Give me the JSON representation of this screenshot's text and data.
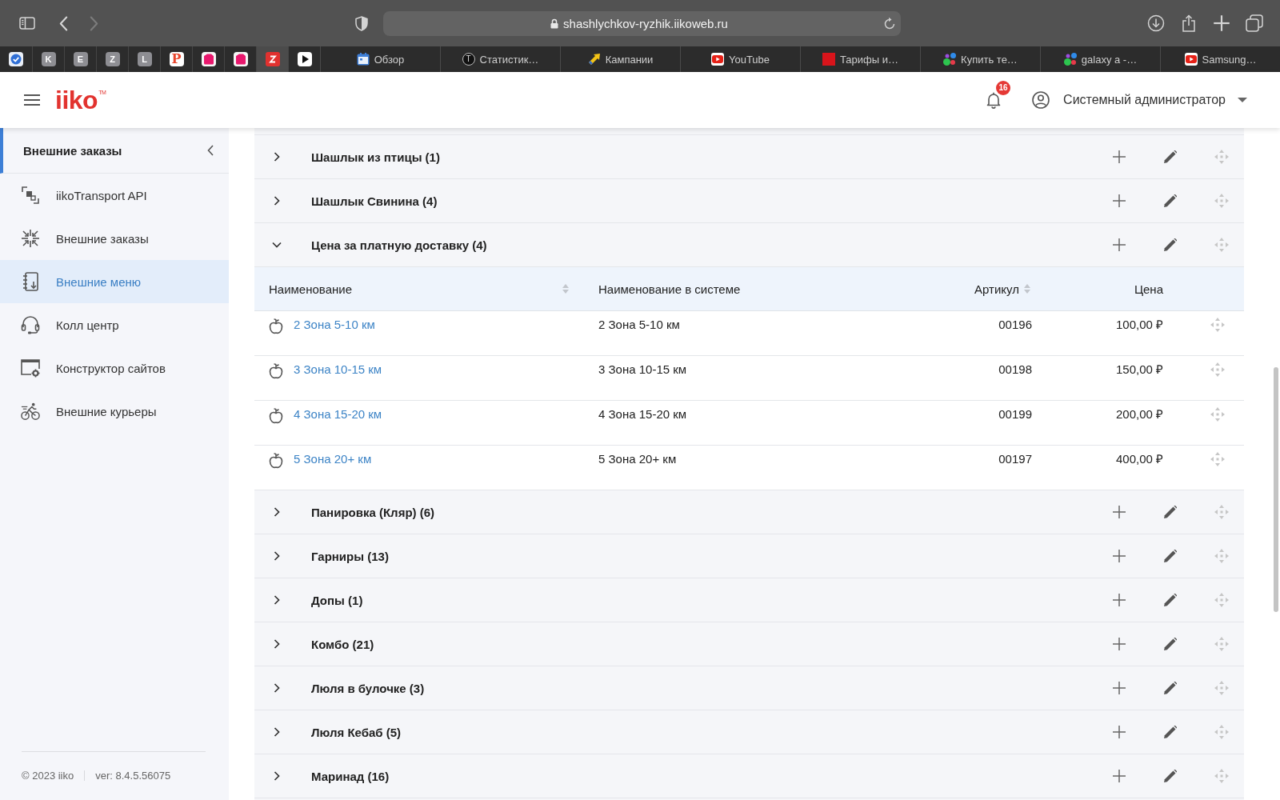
{
  "browser": {
    "back": {
      "disabled": false
    },
    "forward": {
      "disabled": true
    },
    "address": "shashlychkov-ryzhik.iikoweb.ru",
    "pinned_tabs": [
      {
        "kind": "check",
        "selected": false
      },
      {
        "kind": "letter",
        "letter": "K",
        "selected": false
      },
      {
        "kind": "letter",
        "letter": "E",
        "selected": false
      },
      {
        "kind": "letter",
        "letter": "Z",
        "selected": false
      },
      {
        "kind": "letter",
        "letter": "L",
        "selected": false
      },
      {
        "kind": "p-logo",
        "letter": "P",
        "selected": false
      },
      {
        "kind": "tile",
        "selected": false
      },
      {
        "kind": "tile",
        "selected": false
      },
      {
        "kind": "zigzag",
        "selected": true
      },
      {
        "kind": "play",
        "selected": false
      }
    ],
    "tabs": [
      {
        "kind": "calendar",
        "title": "Обзор",
        "selected": false
      },
      {
        "kind": "circle-letter",
        "letter": "T",
        "title": "Статистик…",
        "selected": false
      },
      {
        "kind": "arrow",
        "title": "Кампании",
        "selected": false
      },
      {
        "kind": "video",
        "title": "YouTube",
        "selected": false
      },
      {
        "kind": "square",
        "title": "Тарифы и…",
        "selected": false
      },
      {
        "kind": "dots",
        "title": "Купить те…",
        "selected": false
      },
      {
        "kind": "dots",
        "title": "galaxy a -…",
        "selected": false
      },
      {
        "kind": "video",
        "title": "Samsung…",
        "selected": false
      }
    ]
  },
  "header": {
    "logo": "iiko$^{TM}$",
    "notifications": "16",
    "user": "Системный администратор"
  },
  "sidebar": {
    "title": "Внешние заказы",
    "items": [
      {
        "kind": "transport",
        "label": "iikoTransport API",
        "selected": false
      },
      {
        "kind": "arrows",
        "label": "Внешние заказы",
        "selected": false
      },
      {
        "kind": "notebook",
        "label": "Внешние меню",
        "selected": true
      },
      {
        "kind": "headset",
        "label": "Колл центр",
        "selected": false
      },
      {
        "kind": "window-gear",
        "label": "Конструктор сайтов",
        "selected": false
      },
      {
        "kind": "bicycle",
        "label": "Внешние курьеры",
        "selected": false
      }
    ],
    "footer": {
      "copyright": "© 2023 iiko",
      "version": "ver: 8.4.5.56075"
    }
  },
  "groups": [
    {
      "title": "Шашлык из птицы (1)",
      "expanded": false
    },
    {
      "title": "Шашлык Свинина (4)",
      "expanded": false
    },
    {
      "title": "Цена за платную доставку (4)",
      "expanded": true,
      "table": {
        "columns": [
          {
            "label": "Наименование",
            "sortable": true
          },
          {
            "label": "Наименование в системе",
            "sortable": false
          },
          {
            "label": "Артикул",
            "sortable": true
          },
          {
            "label": "Цена",
            "sortable": false
          }
        ],
        "rows": [
          {
            "name": "2 Зона 5-10 км",
            "system_name": "2 Зона 5-10 км",
            "article": "00196",
            "price": "100,00 ₽"
          },
          {
            "name": "3 Зона 10-15 км",
            "system_name": "3 Зона 10-15 км",
            "article": "00198",
            "price": "150,00 ₽"
          },
          {
            "name": "4 Зона 15-20 км",
            "system_name": "4 Зона 15-20 км",
            "article": "00199",
            "price": "200,00 ₽"
          },
          {
            "name": "5 Зона 20+ км",
            "system_name": "5 Зона 20+ км",
            "article": "00197",
            "price": "400,00 ₽"
          }
        ]
      }
    },
    {
      "title": "Панировка (Кляр) (6)",
      "expanded": false
    },
    {
      "title": "Гарниры (13)",
      "expanded": false
    },
    {
      "title": "Допы (1)",
      "expanded": false
    },
    {
      "title": "Комбо (21)",
      "expanded": false
    },
    {
      "title": "Люля в булочке (3)",
      "expanded": false
    },
    {
      "title": "Люля Кебаб (5)",
      "expanded": false
    },
    {
      "title": "Маринад (16)",
      "expanded": false
    }
  ]
}
